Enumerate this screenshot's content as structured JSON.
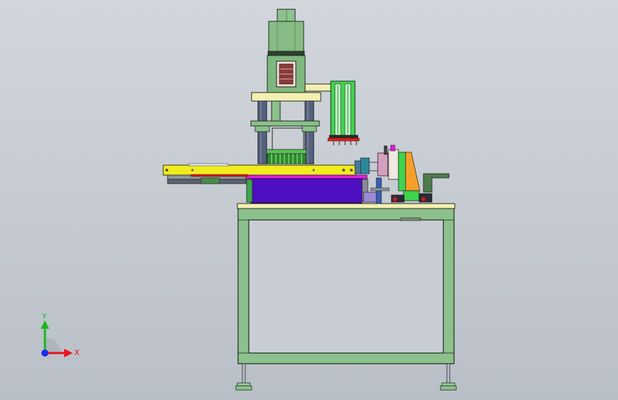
{
  "window": {
    "background_top": "#d2d6dc",
    "background_bottom": "#b9bfc7"
  },
  "triad": {
    "x_label": "X",
    "y_label": "Y",
    "x_color": "#e8141c",
    "y_color": "#1cb81c",
    "z_color": "#1c2ce8"
  },
  "colors": {
    "frame_green": "#8cc08c",
    "frame_edge": "#1d2e1d",
    "top_plate": "#f2f0b2",
    "yellow": "#f0ec1e",
    "purple": "#4d0fbf",
    "magenta": "#e01ee0",
    "orange": "#f4a02a",
    "pillar": "#54607a",
    "bright_green": "#3fd44f"
  }
}
